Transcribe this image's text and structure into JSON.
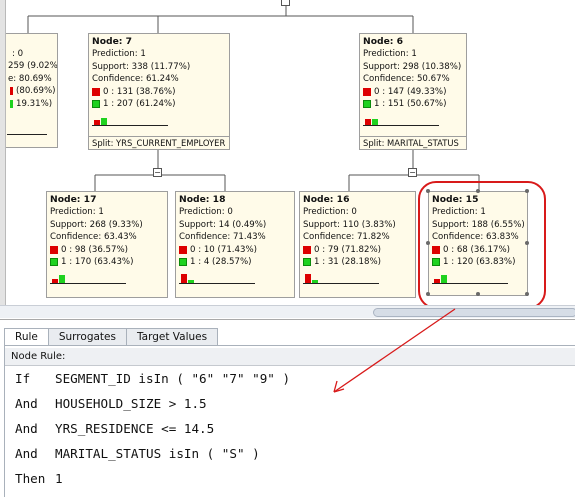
{
  "tree": {
    "partial_left_node": {
      "lines": [
        ": 0",
        "259 (9.02%)",
        "e: 80.69%",
        "(80.69%)",
        "19.31%)"
      ]
    },
    "nodes": [
      {
        "id": "node-7",
        "title": "Node: 7",
        "prediction": "Prediction: 1",
        "support": "Support: 338 (11.77%)",
        "confidence": "Confidence: 61.24%",
        "class0": "0 : 131  (38.76%)",
        "class1": "1 : 207  (61.24%)",
        "hist": [
          0.39,
          0.61
        ],
        "split": "Split: YRS_CURRENT_EMPLOYER"
      },
      {
        "id": "node-6",
        "title": "Node: 6",
        "prediction": "Prediction: 1",
        "support": "Support: 298 (10.38%)",
        "confidence": "Confidence: 50.67%",
        "class0": "0 : 147  (49.33%)",
        "class1": "1 : 151  (50.67%)",
        "hist": [
          0.49,
          0.51
        ],
        "split": "Split: MARITAL_STATUS"
      },
      {
        "id": "node-17",
        "title": "Node: 17",
        "prediction": "Prediction: 1",
        "support": "Support: 268 (9.33%)",
        "confidence": "Confidence: 63.43%",
        "class0": "0 : 98  (36.57%)",
        "class1": "1 : 170  (63.43%)",
        "hist": [
          0.37,
          0.63
        ]
      },
      {
        "id": "node-18",
        "title": "Node: 18",
        "prediction": "Prediction: 0",
        "support": "Support: 14 (0.49%)",
        "confidence": "Confidence: 71.43%",
        "class0": "0 : 10  (71.43%)",
        "class1": "1 : 4  (28.57%)",
        "hist": [
          0.71,
          0.29
        ]
      },
      {
        "id": "node-16",
        "title": "Node: 16",
        "prediction": "Prediction: 0",
        "support": "Support: 110 (3.83%)",
        "confidence": "Confidence: 71.82%",
        "class0": "0 : 79  (71.82%)",
        "class1": "1 : 31  (28.18%)",
        "hist": [
          0.72,
          0.28
        ]
      },
      {
        "id": "node-15",
        "title": "Node: 15",
        "prediction": "Prediction: 1",
        "support": "Support: 188 (6.55%)",
        "confidence": "Confidence: 63.83%",
        "class0": "0 : 68  (36.17%)",
        "class1": "1 : 120  (63.83%)",
        "hist": [
          0.36,
          0.64
        ]
      }
    ],
    "colors": {
      "class0": "#dd0000",
      "class1": "#1fd21f",
      "highlight": "#d81a1a",
      "node_bg": "#fffbe9"
    }
  },
  "tabs": [
    {
      "label": "Rule",
      "active": true
    },
    {
      "label": "Surrogates",
      "active": false
    },
    {
      "label": "Target Values",
      "active": false
    }
  ],
  "rule_panel": {
    "header": "Node Rule:",
    "lines": [
      {
        "kw": "If",
        "text": "SEGMENT_ID isIn ( \"6\" \"7\" \"9\" )"
      },
      {
        "kw": "And",
        "text": "HOUSEHOLD_SIZE > 1.5"
      },
      {
        "kw": "And",
        "text": "YRS_RESIDENCE <= 14.5"
      },
      {
        "kw": "And",
        "text": "MARITAL_STATUS isIn ( \"S\" )"
      },
      {
        "kw": "Then",
        "text": "1"
      }
    ]
  }
}
